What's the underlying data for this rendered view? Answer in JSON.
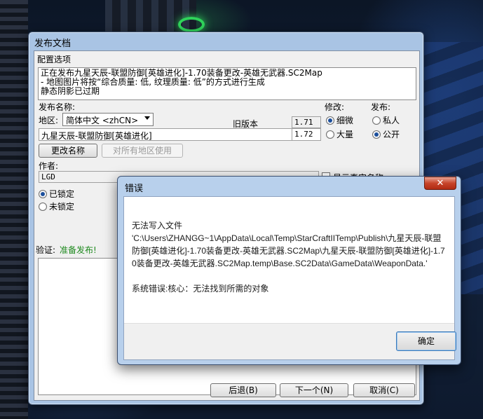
{
  "main_window": {
    "title": "发布文档",
    "config_label": "配置选项",
    "status_lines": [
      "正在发布九星天辰-联盟防御[英雄进化]-1.70装备更改-英雄无武器.SC2Map",
      "- 地图图片将按“综合质量: 低, 纹理质量: 低”的方式进行生成",
      "静态阴影已过期"
    ],
    "publish_name_label": "发布名称:",
    "region_label": "地区:",
    "region_value": "简体中文 <zhCN>",
    "old_version_label": "旧版本",
    "old_version_value": "1.71",
    "new_version_value": "1.72",
    "map_name_value": "九星天辰-联盟防御[英雄进化]",
    "modify_label": "修改:",
    "modify_options": [
      "细微",
      "大量"
    ],
    "publish_label": "发布:",
    "publish_options": [
      "私人",
      "公开"
    ],
    "rename_button": "更改名称",
    "use_all_regions_button": "对所有地区使用",
    "author_label": "作者:",
    "author_value": "LGD",
    "show_real_name_label": "显示真实名称",
    "lock_options": [
      "已锁定",
      "未锁定"
    ],
    "verify_label": "验证:",
    "verify_value": "准备发布!",
    "back_button": "后退(B)",
    "next_button": "下一个(N)",
    "cancel_button": "取消(C)"
  },
  "error_dialog": {
    "title": "错误",
    "close_glyph": "✕",
    "message_line1": "无法写入文件",
    "message_path": "'C:\\Users\\ZHANGG~1\\AppData\\Local\\Temp\\StarCraftIITemp\\Publish\\九星天辰-联盟防御[英雄进化]-1.70装备更改-英雄无武器.SC2Map\\九星天辰-联盟防御[英雄进化]-1.70装备更改-英雄无武器.SC2Map.temp\\Base.SC2Data\\GameData\\WeaponData.'",
    "system_error": "系统错误:核心：无法找到所需的对象",
    "ok_button": "确定"
  }
}
